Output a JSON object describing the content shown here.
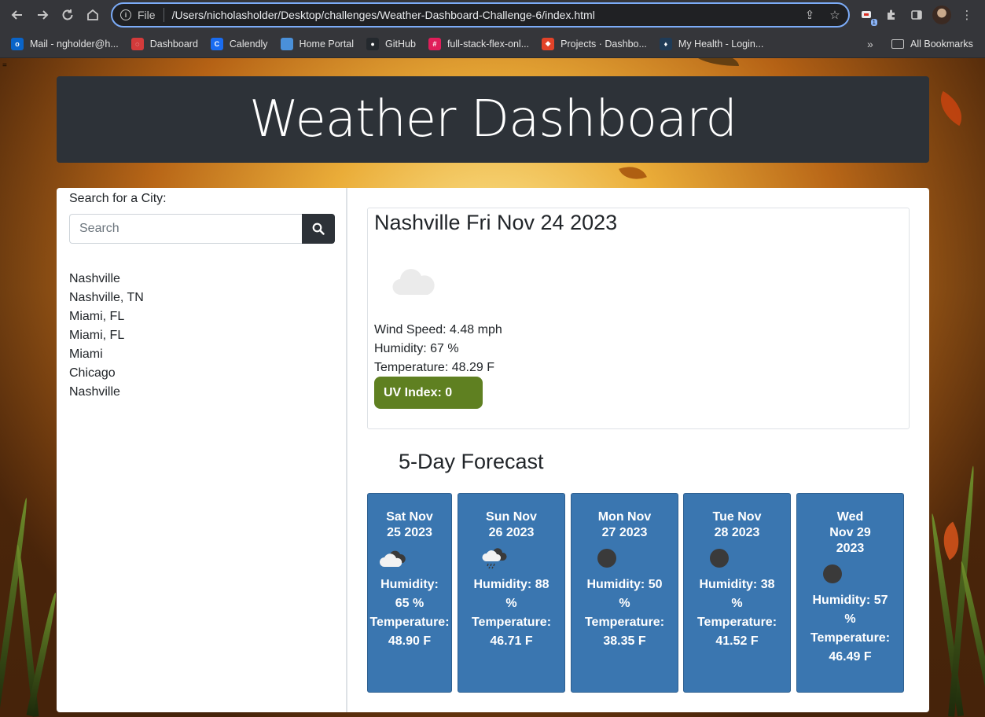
{
  "browser": {
    "scheme": "File",
    "url": "/Users/nicholasholder/Desktop/challenges/Weather-Dashboard-Challenge-6/index.html",
    "bookmarks": [
      {
        "label": "Mail - ngholder@h...",
        "color": "#0a64c8",
        "glyph": "o"
      },
      {
        "label": "Dashboard",
        "color": "#d33b3b",
        "glyph": "◌"
      },
      {
        "label": "Calendly",
        "color": "#1a6cf0",
        "glyph": "C"
      },
      {
        "label": "Home Portal",
        "color": "#4a90d9",
        "glyph": ""
      },
      {
        "label": "GitHub",
        "color": "#24292e",
        "glyph": "●"
      },
      {
        "label": "full-stack-flex-onl...",
        "color": "#e01e5a",
        "glyph": "#"
      },
      {
        "label": "Projects · Dashbo...",
        "color": "#e24329",
        "glyph": "◆"
      },
      {
        "label": "My Health - Login...",
        "color": "#1f3b57",
        "glyph": "♦"
      }
    ],
    "more_label": "»",
    "all_bookmarks": "All Bookmarks",
    "extension_badge": "1"
  },
  "header": {
    "title": "Weather Dashboard"
  },
  "sidebar": {
    "search_label": "Search for a City:",
    "search_placeholder": "Search",
    "history": [
      "Nashville",
      "Nashville, TN",
      "Miami, FL",
      "Miami, FL",
      "Miami",
      "Chicago",
      "Nashville"
    ]
  },
  "current": {
    "heading": "Nashville Fri Nov 24 2023",
    "icon": "cloud-icon",
    "wind": "Wind Speed: 4.48 mph",
    "humidity": "Humidity: 67 %",
    "temperature": "Temperature: 48.29 F",
    "uv": "UV Index: 0",
    "uv_color": "#5f8021"
  },
  "forecast": {
    "title": "5-Day Forecast",
    "card_color": "#3a76b0",
    "days": [
      {
        "date": "Sat Nov 25 2023",
        "icon": "cloudy-icon",
        "humidity": "Humidity: 65 %",
        "temp_label": "Temperature:",
        "temp": "48.90 F"
      },
      {
        "date": "Sun Nov 26 2023",
        "icon": "rain-icon",
        "humidity": "Humidity: 88 %",
        "temp_label": "Temperature:",
        "temp": "46.71 F"
      },
      {
        "date": "Mon Nov 27 2023",
        "icon": "clear-night-icon",
        "humidity": "Humidity: 50 %",
        "temp_label": "Temperature:",
        "temp": "38.35 F"
      },
      {
        "date": "Tue Nov 28 2023",
        "icon": "clear-night-icon",
        "humidity": "Humidity: 38 %",
        "temp_label": "Temperature:",
        "temp": "41.52 F"
      },
      {
        "date": "Wed Nov 29 2023",
        "icon": "clear-night-icon",
        "humidity": "Humidity: 57 %",
        "temp_label": "Temperature:",
        "temp": "46.49 F"
      }
    ]
  }
}
